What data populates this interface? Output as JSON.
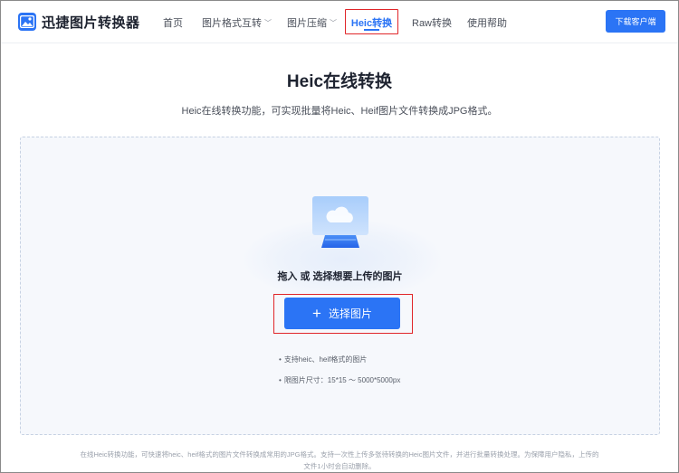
{
  "app": {
    "name": "迅捷图片转换器"
  },
  "nav": {
    "items": [
      {
        "label": "首页"
      },
      {
        "label": "图片格式互转"
      },
      {
        "label": "图片压缩"
      },
      {
        "label": "Heic转换"
      },
      {
        "label": "Raw转换"
      },
      {
        "label": "使用帮助"
      }
    ],
    "active_index": 3,
    "download_label": "下载客户端"
  },
  "page": {
    "title": "Heic在线转换",
    "subtitle": "Heic在线转换功能，可实现批量将Heic、Heif图片文件转换成JPG格式。"
  },
  "upload": {
    "prompt": "拖入 或 选择想要上传的图片",
    "button_label": "选择图片",
    "tips": [
      "支持heic、heif格式的图片",
      "限图片尺寸：15*15 ～ 5000*5000px"
    ]
  },
  "footer": {
    "line1": "在线Heic转换功能，可快速将heic、heif格式的图片文件转换成常用的JPG格式。支持一次性上传多张待转换的Heic图片文件，并进行批量转换处理。为保障用户隐私，上传的",
    "line2": "文件1小时会自动删除。"
  },
  "colors": {
    "accent": "#2b74f5",
    "highlight": "#e0262a"
  }
}
